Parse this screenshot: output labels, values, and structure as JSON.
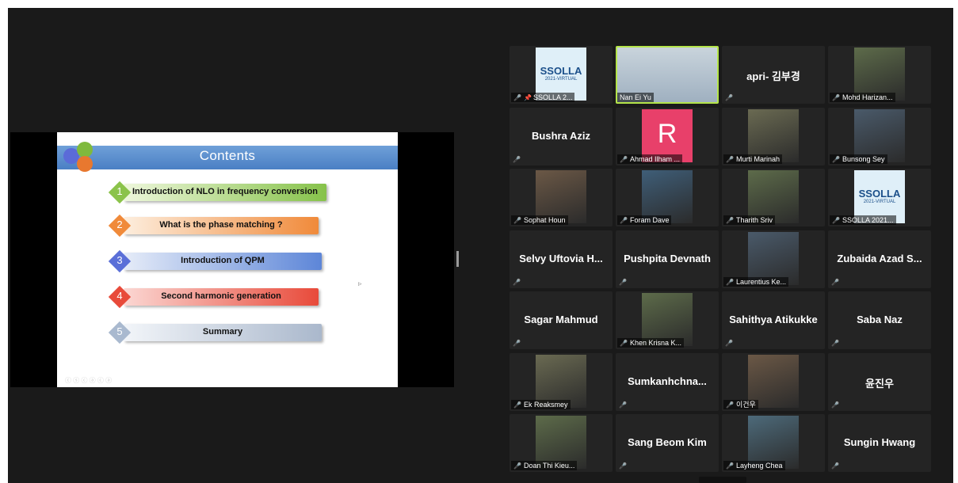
{
  "slide": {
    "title": "Contents",
    "items": [
      {
        "num": "1",
        "label": "Introduction of NLO in frequency conversion",
        "color": "#8bc34a",
        "barFrom": "#eef7dc",
        "barTo": "#86c24a"
      },
      {
        "num": "2",
        "label": "What is the phase matching ?",
        "color": "#f08a3a",
        "barFrom": "#fdeede",
        "barTo": "#f08a3a"
      },
      {
        "num": "3",
        "label": "Introduction of QPM",
        "color": "#5a6fd8",
        "barFrom": "#e6ecf8",
        "barTo": "#5d86d8"
      },
      {
        "num": "4",
        "label": "Second harmonic generation",
        "color": "#e84a3a",
        "barFrom": "#fbd7d3",
        "barTo": "#e84a3a"
      },
      {
        "num": "5",
        "label": "Summary",
        "color": "#a9b9cf",
        "barFrom": "#f2f5f9",
        "barTo": "#aab8cc"
      }
    ],
    "footer": "ⓒ ⓢ ⓒ ⓐ ⓒ ⓐ"
  },
  "participants": [
    {
      "name": "SSOLLA 2...",
      "display": "logo",
      "pinned": true
    },
    {
      "name": "Nan Ei Yu",
      "display": "video",
      "active": true
    },
    {
      "name": "apri- 김부경",
      "display": "name"
    },
    {
      "name": "Mohd Harizan...",
      "display": "video"
    },
    {
      "name": "Bushra Aziz",
      "display": "name"
    },
    {
      "name": "Ahmad Ilham ...",
      "display": "letter",
      "letter": "R"
    },
    {
      "name": "Murti Marinah",
      "display": "video"
    },
    {
      "name": "Bunsong Sey",
      "display": "video"
    },
    {
      "name": "Sophat Houn",
      "display": "video"
    },
    {
      "name": "Foram Dave",
      "display": "video"
    },
    {
      "name": "Tharith Sriv",
      "display": "video"
    },
    {
      "name": "SSOLLA 2021...",
      "display": "logo"
    },
    {
      "name": "Selvy Uftovia H...",
      "display": "name"
    },
    {
      "name": "Pushpita Devnath",
      "display": "name"
    },
    {
      "name": "Laurentius Ke...",
      "display": "video"
    },
    {
      "name": "Zubaida Azad S...",
      "display": "name"
    },
    {
      "name": "Sagar Mahmud",
      "display": "name"
    },
    {
      "name": "Khen Krisna K...",
      "display": "video"
    },
    {
      "name": "Sahithya Atikukke",
      "display": "name"
    },
    {
      "name": "Saba Naz",
      "display": "name"
    },
    {
      "name": "Ek Reaksmey",
      "display": "video"
    },
    {
      "name": "Sumkanhchna...",
      "display": "name"
    },
    {
      "name": "이건우",
      "display": "video"
    },
    {
      "name": "윤진우",
      "display": "name"
    },
    {
      "name": "Doan Thi Kieu...",
      "display": "video"
    },
    {
      "name": "Sang Beom Kim",
      "display": "name"
    },
    {
      "name": "Layheng Chea",
      "display": "video"
    },
    {
      "name": "Sungin Hwang",
      "display": "name"
    }
  ],
  "logoText": "SSOLLA",
  "logoSub": "2021-VIRTUAL",
  "colors": {
    "activeBorder": "#b4e44a",
    "tile": "#242424",
    "muted": "#e63b3b"
  }
}
